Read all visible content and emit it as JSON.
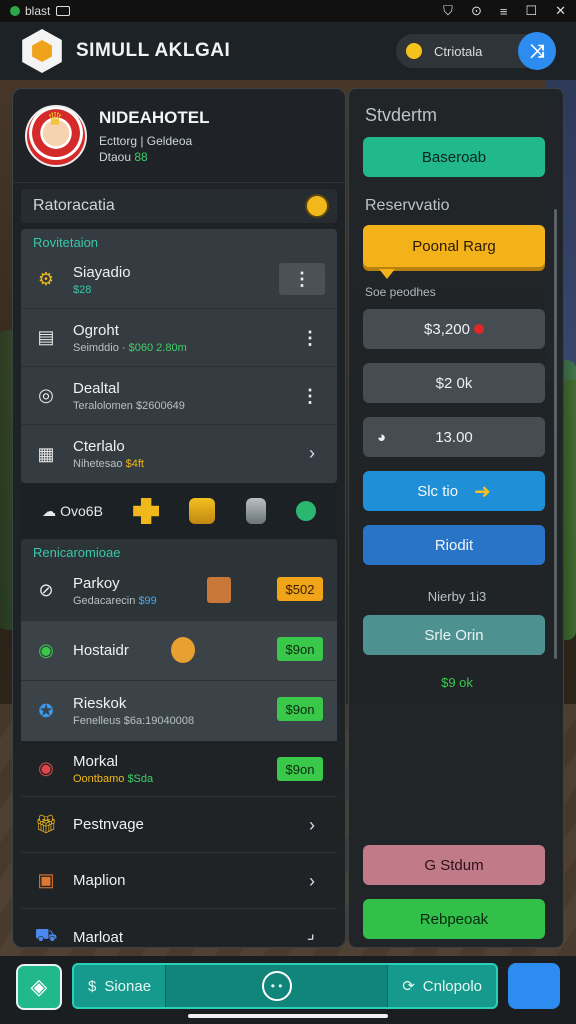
{
  "status_bar": {
    "left_text": "blast",
    "right_icons": [
      "shield-icon",
      "signal-icon",
      "menu-icon",
      "square-icon",
      "close-icon"
    ]
  },
  "app": {
    "title": "SIMULL AKLGAI",
    "profile_label": "Ctriotala",
    "action_icon": "swap-icon"
  },
  "hotel": {
    "name": "NIDEAHOTEL",
    "line1": "Ecttorg | Geldeoa",
    "line2_prefix": "Dtaou",
    "line2_badge": "88"
  },
  "left": {
    "section_title": "Ratoracatia",
    "group1_title": "Rovitetaion",
    "items1": [
      {
        "title": "Siayadio",
        "sub": "$28",
        "icon": "gear-icon"
      },
      {
        "title": "Ogroht",
        "sub": "Seimddio",
        "sub_green": "$060 2.80m",
        "icon": "document-icon"
      },
      {
        "title": "Dealtal",
        "sub": "Teralolomen $2600649",
        "icon": "gauge-icon"
      },
      {
        "title": "Cterlalo",
        "sub": "Nihetesao",
        "sub_yellow": "$4ft",
        "icon": "building-icon"
      }
    ],
    "icon_row": {
      "label": "Ovo6B",
      "icons": [
        "cloud-icon",
        "puzzle-icon",
        "gift-icon",
        "bag-icon",
        "gem-icon"
      ]
    },
    "group2_title": "Renicaromioae",
    "items2": [
      {
        "title": "Parkoy",
        "sub": "Gedacarecin",
        "sub_badge": "$99",
        "tag": "$502",
        "icon": "steering-icon"
      },
      {
        "title": "Hostaidr",
        "tag": "$9on",
        "icon": "ring-icon"
      },
      {
        "title": "Rieskok",
        "sub": "Fenelleus $6a:19040008",
        "tag": "$9on",
        "icon": "badge-icon"
      }
    ],
    "items3": [
      {
        "title": "Morkal",
        "sub_yellow": "Oontbamo",
        "sub_green": "$Sda",
        "tag": "$9on",
        "icon": "target-icon"
      },
      {
        "title": "Pestnvage",
        "icon": "gift-icon"
      },
      {
        "title": "Maplion",
        "icon": "chest-icon"
      },
      {
        "title": "Marloat",
        "icon": "cart-icon"
      }
    ]
  },
  "right": {
    "title": "Stvdertm",
    "btn_top": "Baseroab",
    "reservation_title": "Reservvatio",
    "gold_btn": "Poonal Rarg",
    "small_label": "Soe peodhes",
    "price1": "$3,200",
    "price2": "$2 0k",
    "price3": "13.00",
    "btn_blue1": "Slc tio",
    "btn_blue2": "Riodit",
    "nearby": "Nierby 1i3",
    "btn_sage": "Srle Orin",
    "green_tag": "$9 ok",
    "btn_rose": "G Stdum",
    "btn_green": "Rebpeoak"
  },
  "bottom": {
    "left_label": "Sionae",
    "mid_icon": "smile-icon",
    "right_label": "Cnlopolo"
  }
}
